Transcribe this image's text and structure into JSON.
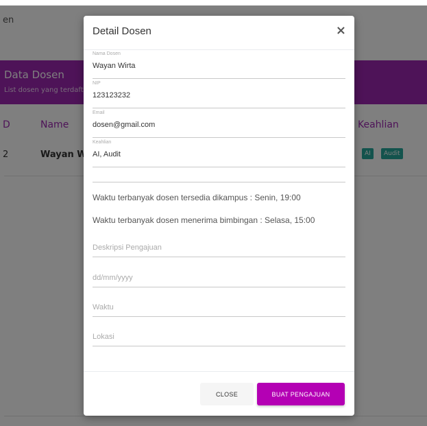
{
  "background": {
    "breadcrumb": "en",
    "card_title": "Data Dosen",
    "card_subtitle": "List dosen yang terdaftar",
    "columns": [
      "D",
      "Name",
      "Keahlian"
    ],
    "row": {
      "id": "2",
      "name": "Wayan Wirt",
      "tags": [
        "AI",
        "Audit"
      ]
    }
  },
  "modal": {
    "title": "Detail Dosen",
    "close_icon": "×",
    "fields": [
      {
        "label": "Nama Dosen",
        "value": "Wayan Wirta"
      },
      {
        "label": "NIP",
        "value": "123123232"
      },
      {
        "label": "Email",
        "value": "dosen@gmail.com"
      },
      {
        "label": "Keahlian",
        "value": "AI, Audit"
      }
    ],
    "info_available": "Waktu terbanyak dosen tersedia dikampus : Senin, 19:00",
    "info_guidance": "Waktu terbanyak dosen menerima bimbingan : Selasa, 15:00",
    "form": {
      "deskripsi_placeholder": "Deskripsi Pengajuan",
      "tanggal_placeholder": "dd/mm/yyyy",
      "waktu_placeholder": "Waktu",
      "lokasi_placeholder": "Lokasi"
    },
    "buttons": {
      "close": "CLOSE",
      "submit": "BUAT PENGAJUAN"
    }
  },
  "colors": {
    "accent": "#b400b4",
    "header": "#9c27b0",
    "badge": "#26a69a"
  }
}
